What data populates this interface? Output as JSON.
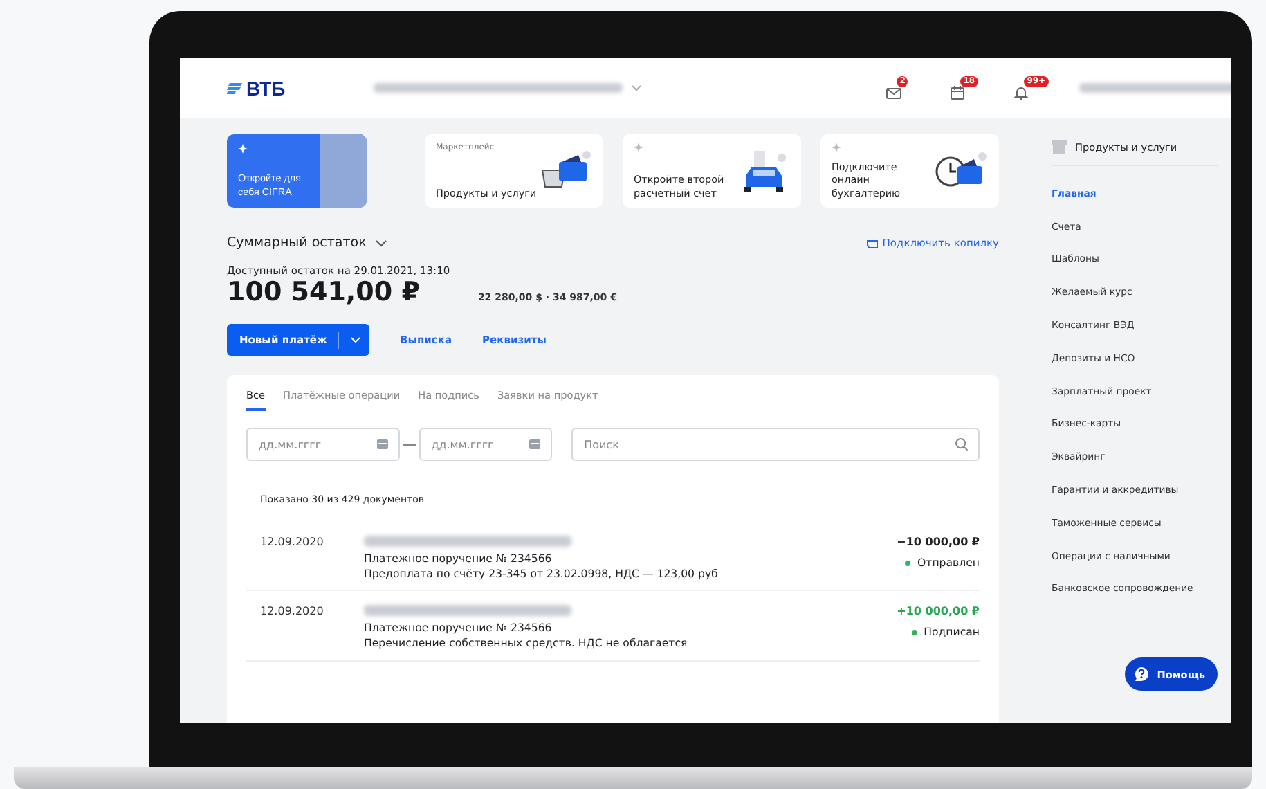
{
  "header": {
    "logo": "ВТБ",
    "notifications": [
      {
        "kind": "mail",
        "badge": "2"
      },
      {
        "kind": "calendar",
        "badge": "18"
      },
      {
        "kind": "bell",
        "badge": "99+"
      }
    ]
  },
  "promo_cards": [
    {
      "kind": "banner",
      "title": "Откройте для себя CIFRA"
    },
    {
      "kind": "basket",
      "kicker": "Маркетплейс",
      "title": "Продукты и услуги"
    },
    {
      "kind": "car",
      "title": "Откройте второй расчетный счет"
    },
    {
      "kind": "clock",
      "title": "Подключите онлайн бухгалтерию"
    }
  ],
  "balance": {
    "title": "Суммарный остаток",
    "piggy_link": "Подключить копилку",
    "available": "Доступный остаток на 29.01.2021, 13:10",
    "amount": "100 541,00 ₽",
    "other_currencies": "22 280,00 $ · 34 987,00 €"
  },
  "actions": {
    "primary": "Новый платёж",
    "links": [
      "Выписка",
      "Реквизиты"
    ]
  },
  "documents": {
    "tabs": [
      {
        "label": "Все",
        "selected": true
      },
      {
        "label": "Платёжные операции",
        "selected": false
      },
      {
        "label": "На подпись",
        "selected": false
      },
      {
        "label": "Заявки на продукт",
        "selected": false
      }
    ],
    "date_from": {
      "placeholder": "дд.мм.гггг"
    },
    "date_to": {
      "placeholder": "дд.мм.гггг"
    },
    "search": {
      "placeholder": "Поиск"
    },
    "shown": "Показано 30 из 429 документов",
    "rows": [
      {
        "date": "12.09.2020",
        "title": "Платежное поручение № 234566",
        "description": "Предоплата по счёту 23-345 от 23.02.0998, НДС — 123,00 руб",
        "amount": "−10 000,00 ₽",
        "kind": "debit",
        "status": "Отправлен",
        "color": "#2fb45a"
      },
      {
        "date": "12.09.2020",
        "title": "Платежное поручение № 234566",
        "description": "Перечисление собственных средств. НДС не облагается",
        "amount": "+10 000,00 ₽",
        "kind": "credit",
        "status": "Подписан",
        "color": "#2fb45a"
      }
    ]
  },
  "sidebar": {
    "title": "Продукты и услуги",
    "items": [
      {
        "label": "Главная",
        "selected": true
      },
      {
        "label": "Счета",
        "selected": false
      },
      {
        "label": "Шаблоны",
        "selected": false
      },
      {
        "label": "Желаемый курс",
        "selected": false
      },
      {
        "label": "Консалтинг ВЭД",
        "selected": false
      },
      {
        "label": "Депозиты и НСО",
        "selected": false
      },
      {
        "label": "Зарплатный проект",
        "selected": false
      },
      {
        "label": "Бизнес-карты",
        "selected": false
      },
      {
        "label": "Эквайринг",
        "selected": false
      },
      {
        "label": "Гарантии и аккредитивы",
        "selected": false
      },
      {
        "label": "Таможенные сервисы",
        "selected": false
      },
      {
        "label": "Операции с наличными",
        "selected": false
      },
      {
        "label": "Банковское сопровождение",
        "selected": false
      }
    ]
  },
  "help_button": "Помощь"
}
